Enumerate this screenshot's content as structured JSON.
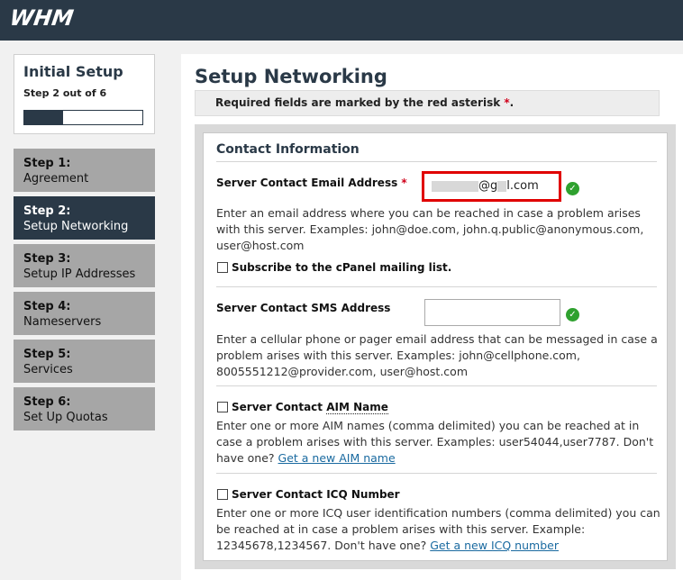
{
  "header": {
    "logo": "WHM"
  },
  "sidebar": {
    "title": "Initial Setup",
    "step_text": "Step 2 out of 6",
    "progress_fraction": 0.33,
    "steps": [
      {
        "num": "Step 1:",
        "label": "Agreement"
      },
      {
        "num": "Step 2:",
        "label": "Setup Networking"
      },
      {
        "num": "Step 3:",
        "label": "Setup IP Addresses"
      },
      {
        "num": "Step 4:",
        "label": "Nameservers"
      },
      {
        "num": "Step 5:",
        "label": "Services"
      },
      {
        "num": "Step 6:",
        "label": "Set Up Quotas"
      }
    ]
  },
  "main": {
    "title": "Setup Networking",
    "notice": "Required fields are marked by the red asterisk",
    "notice_asterisk": "*",
    "notice_end": ".",
    "panel_title": "Contact Information",
    "email": {
      "label": "Server Contact Email Address",
      "asterisk": "*",
      "value_suffix": "@g",
      "value_domain": "l.com",
      "desc": "Enter an email address where you can be reached in case a problem arises with this server. Examples: john@doe.com, john.q.public@anonymous.com, user@host.com"
    },
    "subscribe": {
      "label": "Subscribe to the cPanel mailing list."
    },
    "sms": {
      "label": "Server Contact SMS Address",
      "value": "",
      "desc": "Enter a cellular phone or pager email address that can be messaged in case a problem arises with this server. Examples: john@cellphone.com, 8005551212@provider.com, user@host.com"
    },
    "aim": {
      "label_prefix": "Server Contact ",
      "label_abbr": "AIM Name",
      "desc": "Enter one or more AIM names (comma delimited) you can be reached at in case a problem arises with this server. Examples: user54044,user7787. Don't have one?",
      "link": "Get a new AIM name"
    },
    "icq": {
      "label": "Server Contact ICQ Number",
      "desc": "Enter one or more ICQ user identification numbers (comma delimited) you can be reached at in case a problem arises with this server. Example: 12345678,1234567. Don't have one?",
      "link": "Get a new ICQ number"
    }
  }
}
